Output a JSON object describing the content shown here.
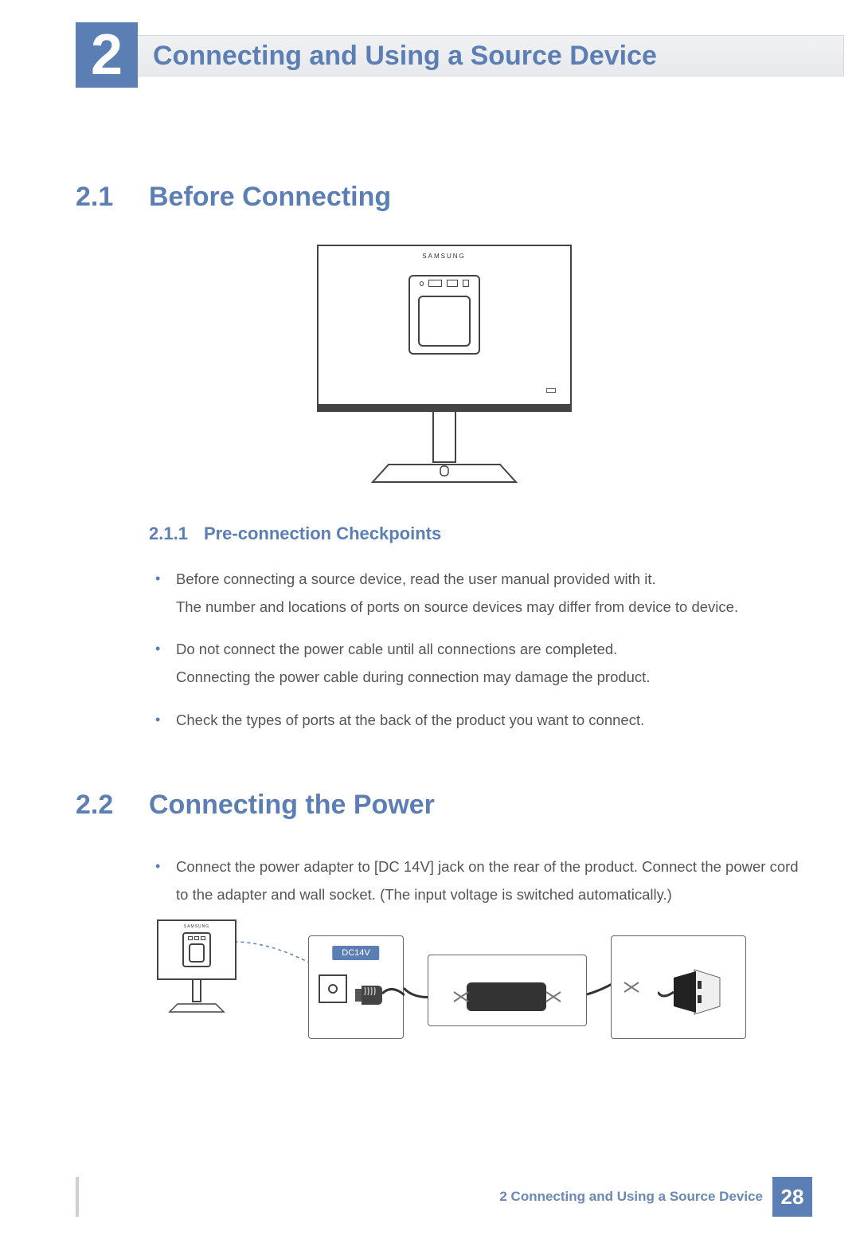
{
  "chapter": {
    "number": "2",
    "title": "Connecting and Using a Source Device"
  },
  "sections": {
    "s21": {
      "number": "2.1",
      "title": "Before Connecting",
      "sub": {
        "number": "2.1.1",
        "title": "Pre-connection Checkpoints"
      },
      "bullets": {
        "b1": "Before connecting a source device, read the user manual provided with it.\nThe number and locations of ports on source devices may differ from device to device.",
        "b2": "Do not connect the power cable until all connections are completed.\nConnecting the power cable during connection may damage the product.",
        "b3": "Check the types of ports at the back of the product you want to connect."
      }
    },
    "s22": {
      "number": "2.2",
      "title": "Connecting the Power",
      "bullets": {
        "b1": "Connect the power adapter to [DC 14V] jack on the rear of the product. Connect the power cord to the adapter and wall socket. (The input voltage is switched automatically.)"
      }
    }
  },
  "figure": {
    "monitor_brand": "SAMSUNG",
    "dc_label": "DC14V"
  },
  "footer": {
    "text": "2 Connecting and Using a Source Device",
    "page": "28"
  }
}
